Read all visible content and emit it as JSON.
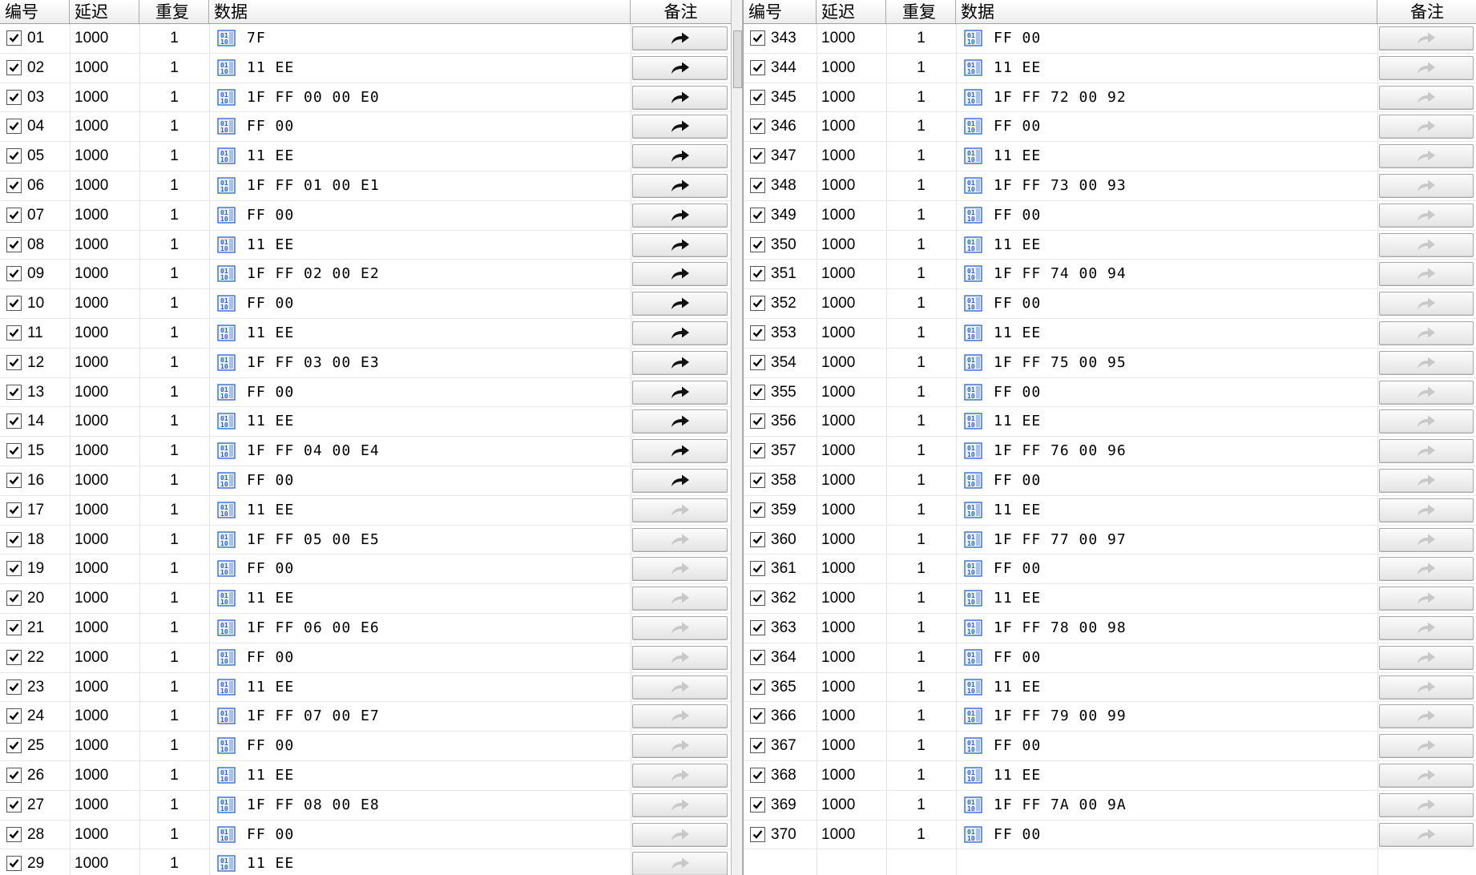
{
  "columns": {
    "id": "编号",
    "delay": "延迟",
    "repeat": "重复",
    "data": "数据",
    "note": "备注"
  },
  "colors": {
    "arrow_active": "#111111",
    "arrow_inactive": "#c8c8c8",
    "icon_blue": "#2a63c9"
  },
  "left_rows": [
    {
      "id": "01",
      "delay": "1000",
      "repeat": "1",
      "data": "7F",
      "checked": true,
      "send_active": true
    },
    {
      "id": "02",
      "delay": "1000",
      "repeat": "1",
      "data": "11 EE",
      "checked": true,
      "send_active": true
    },
    {
      "id": "03",
      "delay": "1000",
      "repeat": "1",
      "data": "1F FF 00 00 E0",
      "checked": true,
      "send_active": true
    },
    {
      "id": "04",
      "delay": "1000",
      "repeat": "1",
      "data": "FF 00",
      "checked": true,
      "send_active": true
    },
    {
      "id": "05",
      "delay": "1000",
      "repeat": "1",
      "data": "11 EE",
      "checked": true,
      "send_active": true
    },
    {
      "id": "06",
      "delay": "1000",
      "repeat": "1",
      "data": "1F FF 01 00 E1",
      "checked": true,
      "send_active": true
    },
    {
      "id": "07",
      "delay": "1000",
      "repeat": "1",
      "data": "FF 00",
      "checked": true,
      "send_active": true
    },
    {
      "id": "08",
      "delay": "1000",
      "repeat": "1",
      "data": "11 EE",
      "checked": true,
      "send_active": true
    },
    {
      "id": "09",
      "delay": "1000",
      "repeat": "1",
      "data": "1F FF 02 00 E2",
      "checked": true,
      "send_active": true
    },
    {
      "id": "10",
      "delay": "1000",
      "repeat": "1",
      "data": "FF 00",
      "checked": true,
      "send_active": true
    },
    {
      "id": "11",
      "delay": "1000",
      "repeat": "1",
      "data": "11 EE",
      "checked": true,
      "send_active": true
    },
    {
      "id": "12",
      "delay": "1000",
      "repeat": "1",
      "data": "1F FF 03 00 E3",
      "checked": true,
      "send_active": true
    },
    {
      "id": "13",
      "delay": "1000",
      "repeat": "1",
      "data": "FF 00",
      "checked": true,
      "send_active": true
    },
    {
      "id": "14",
      "delay": "1000",
      "repeat": "1",
      "data": "11 EE",
      "checked": true,
      "send_active": true
    },
    {
      "id": "15",
      "delay": "1000",
      "repeat": "1",
      "data": "1F FF 04 00 E4",
      "checked": true,
      "send_active": true
    },
    {
      "id": "16",
      "delay": "1000",
      "repeat": "1",
      "data": "FF 00",
      "checked": true,
      "send_active": true
    },
    {
      "id": "17",
      "delay": "1000",
      "repeat": "1",
      "data": "11 EE",
      "checked": true,
      "send_active": false
    },
    {
      "id": "18",
      "delay": "1000",
      "repeat": "1",
      "data": "1F FF 05 00 E5",
      "checked": true,
      "send_active": false
    },
    {
      "id": "19",
      "delay": "1000",
      "repeat": "1",
      "data": "FF 00",
      "checked": true,
      "send_active": false
    },
    {
      "id": "20",
      "delay": "1000",
      "repeat": "1",
      "data": "11 EE",
      "checked": true,
      "send_active": false
    },
    {
      "id": "21",
      "delay": "1000",
      "repeat": "1",
      "data": "1F FF 06 00 E6",
      "checked": true,
      "send_active": false
    },
    {
      "id": "22",
      "delay": "1000",
      "repeat": "1",
      "data": "FF 00",
      "checked": true,
      "send_active": false
    },
    {
      "id": "23",
      "delay": "1000",
      "repeat": "1",
      "data": "11 EE",
      "checked": true,
      "send_active": false
    },
    {
      "id": "24",
      "delay": "1000",
      "repeat": "1",
      "data": "1F FF 07 00 E7",
      "checked": true,
      "send_active": false
    },
    {
      "id": "25",
      "delay": "1000",
      "repeat": "1",
      "data": "FF 00",
      "checked": true,
      "send_active": false
    },
    {
      "id": "26",
      "delay": "1000",
      "repeat": "1",
      "data": "11 EE",
      "checked": true,
      "send_active": false
    },
    {
      "id": "27",
      "delay": "1000",
      "repeat": "1",
      "data": "1F FF 08 00 E8",
      "checked": true,
      "send_active": false
    },
    {
      "id": "28",
      "delay": "1000",
      "repeat": "1",
      "data": "FF 00",
      "checked": true,
      "send_active": false
    },
    {
      "id": "29",
      "delay": "1000",
      "repeat": "1",
      "data": "11 EE",
      "checked": true,
      "send_active": false
    }
  ],
  "right_rows": [
    {
      "id": "343",
      "delay": "1000",
      "repeat": "1",
      "data": "FF 00",
      "checked": true,
      "send_active": false
    },
    {
      "id": "344",
      "delay": "1000",
      "repeat": "1",
      "data": "11 EE",
      "checked": true,
      "send_active": false
    },
    {
      "id": "345",
      "delay": "1000",
      "repeat": "1",
      "data": "1F FF 72 00 92",
      "checked": true,
      "send_active": false
    },
    {
      "id": "346",
      "delay": "1000",
      "repeat": "1",
      "data": "FF 00",
      "checked": true,
      "send_active": false
    },
    {
      "id": "347",
      "delay": "1000",
      "repeat": "1",
      "data": "11 EE",
      "checked": true,
      "send_active": false
    },
    {
      "id": "348",
      "delay": "1000",
      "repeat": "1",
      "data": "1F FF 73 00 93",
      "checked": true,
      "send_active": false
    },
    {
      "id": "349",
      "delay": "1000",
      "repeat": "1",
      "data": "FF 00",
      "checked": true,
      "send_active": false
    },
    {
      "id": "350",
      "delay": "1000",
      "repeat": "1",
      "data": "11 EE",
      "checked": true,
      "send_active": false
    },
    {
      "id": "351",
      "delay": "1000",
      "repeat": "1",
      "data": "1F FF 74 00 94",
      "checked": true,
      "send_active": false
    },
    {
      "id": "352",
      "delay": "1000",
      "repeat": "1",
      "data": "FF 00",
      "checked": true,
      "send_active": false
    },
    {
      "id": "353",
      "delay": "1000",
      "repeat": "1",
      "data": "11 EE",
      "checked": true,
      "send_active": false
    },
    {
      "id": "354",
      "delay": "1000",
      "repeat": "1",
      "data": "1F FF 75 00 95",
      "checked": true,
      "send_active": false
    },
    {
      "id": "355",
      "delay": "1000",
      "repeat": "1",
      "data": "FF 00",
      "checked": true,
      "send_active": false
    },
    {
      "id": "356",
      "delay": "1000",
      "repeat": "1",
      "data": "11 EE",
      "checked": true,
      "send_active": false
    },
    {
      "id": "357",
      "delay": "1000",
      "repeat": "1",
      "data": "1F FF 76 00 96",
      "checked": true,
      "send_active": false
    },
    {
      "id": "358",
      "delay": "1000",
      "repeat": "1",
      "data": "FF 00",
      "checked": true,
      "send_active": false
    },
    {
      "id": "359",
      "delay": "1000",
      "repeat": "1",
      "data": "11 EE",
      "checked": true,
      "send_active": false
    },
    {
      "id": "360",
      "delay": "1000",
      "repeat": "1",
      "data": "1F FF 77 00 97",
      "checked": true,
      "send_active": false
    },
    {
      "id": "361",
      "delay": "1000",
      "repeat": "1",
      "data": "FF 00",
      "checked": true,
      "send_active": false
    },
    {
      "id": "362",
      "delay": "1000",
      "repeat": "1",
      "data": "11 EE",
      "checked": true,
      "send_active": false
    },
    {
      "id": "363",
      "delay": "1000",
      "repeat": "1",
      "data": "1F FF 78 00 98",
      "checked": true,
      "send_active": false
    },
    {
      "id": "364",
      "delay": "1000",
      "repeat": "1",
      "data": "FF 00",
      "checked": true,
      "send_active": false
    },
    {
      "id": "365",
      "delay": "1000",
      "repeat": "1",
      "data": "11 EE",
      "checked": true,
      "send_active": false
    },
    {
      "id": "366",
      "delay": "1000",
      "repeat": "1",
      "data": "1F FF 79 00 99",
      "checked": true,
      "send_active": false
    },
    {
      "id": "367",
      "delay": "1000",
      "repeat": "1",
      "data": "FF 00",
      "checked": true,
      "send_active": false
    },
    {
      "id": "368",
      "delay": "1000",
      "repeat": "1",
      "data": "11 EE",
      "checked": true,
      "send_active": false
    },
    {
      "id": "369",
      "delay": "1000",
      "repeat": "1",
      "data": "1F FF 7A 00 9A",
      "checked": true,
      "send_active": false
    },
    {
      "id": "370",
      "delay": "1000",
      "repeat": "1",
      "data": "FF 00",
      "checked": true,
      "send_active": false
    }
  ]
}
